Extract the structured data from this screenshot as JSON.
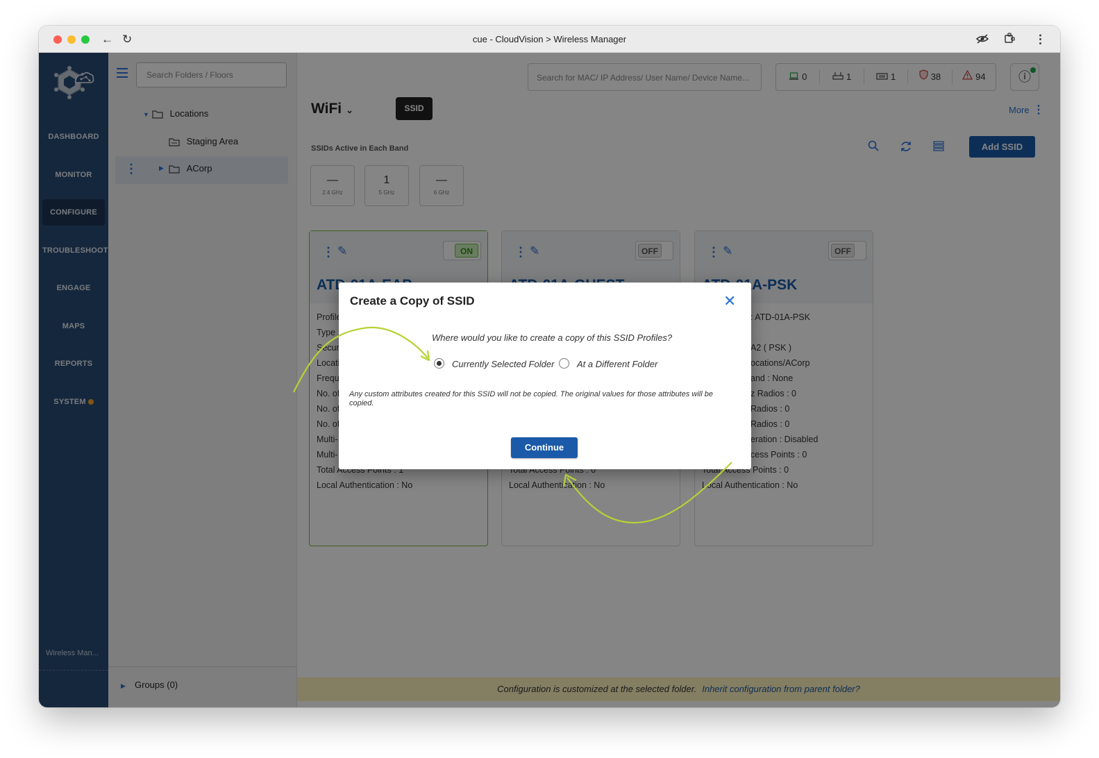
{
  "window": {
    "title": "cue - CloudVision > Wireless Manager"
  },
  "nav": {
    "items": [
      "DASHBOARD",
      "MONITOR",
      "CONFIGURE",
      "TROUBLESHOOT",
      "ENGAGE",
      "MAPS",
      "REPORTS",
      "SYSTEM"
    ],
    "active": "CONFIGURE",
    "footer": "Wireless Man..."
  },
  "tree": {
    "search_placeholder": "Search Folders / Floors",
    "items": [
      "Locations",
      "Staging Area",
      "ACorp"
    ],
    "selected": "ACorp",
    "groups_label": "Groups (0)"
  },
  "header": {
    "search_placeholder": "Search for MAC/ IP Address/ User Name/ Device Name...",
    "counts": [
      {
        "icon": "laptop-icon",
        "value": "0"
      },
      {
        "icon": "access-point-icon",
        "value": "1"
      },
      {
        "icon": "switch-icon",
        "value": "1"
      },
      {
        "icon": "shield-icon",
        "value": "38",
        "color": "#d0453f"
      },
      {
        "icon": "warning-icon",
        "value": "94",
        "color": "#d0453f"
      }
    ]
  },
  "page": {
    "title": "WiFi",
    "tag": "SSID",
    "more_label": "More",
    "band_label": "SSIDs Active in Each Band",
    "add_ssid_label": "Add SSID",
    "bands": [
      {
        "value": "—",
        "name": "2.4 GHz"
      },
      {
        "value": "1",
        "name": "5 GHz"
      },
      {
        "value": "—",
        "name": "6 GHz"
      }
    ]
  },
  "cards": [
    {
      "title": "ATD-01A-EAP",
      "toggle": "ON",
      "lines": [
        "Profile",
        "Type :",
        "Securi",
        "Locati",
        "Frequ",
        "No. of",
        "No. of",
        "No. of",
        "Multi-",
        "Multi-",
        "Total Access Points : 1",
        "Local Authentication : No"
      ]
    },
    {
      "title": "ATD-01A-GUEST",
      "toggle": "OFF",
      "lines": [
        "",
        "",
        "",
        "",
        "",
        "",
        "",
        "",
        "",
        "",
        "Total Access Points : 0",
        "Local Authentication : No"
      ]
    },
    {
      "title": "ATD-01A-PSK",
      "toggle": "OFF",
      "lines": [
        ": ATD-01A-PSK",
        "",
        "A2 ( PSK )",
        "ocations/ACorp",
        "and : None",
        "z Radios : 0",
        "Radios : 0",
        "Radios : 0",
        "eration : Disabled",
        "cess Points : 0",
        "Total Access Points : 0",
        "Local Authentication : No"
      ]
    }
  ],
  "banner": {
    "text": "Configuration is customized at the selected folder.",
    "link": "Inherit configuration from parent folder?"
  },
  "modal": {
    "title": "Create a Copy of SSID",
    "question": "Where would you like to create a copy of this SSID Profiles?",
    "options": [
      "Currently Selected Folder",
      "At a Different Folder"
    ],
    "selected_option": "Currently Selected Folder",
    "note": "Any custom attributes created for this SSID will not be copied. The original values for those attributes will be copied.",
    "continue_label": "Continue"
  },
  "colors": {
    "nav_bg": "#2a4b75",
    "accent": "#1a5aa8",
    "annotation_arrow": "#b5d334",
    "banner_bg": "#fef2bd"
  }
}
